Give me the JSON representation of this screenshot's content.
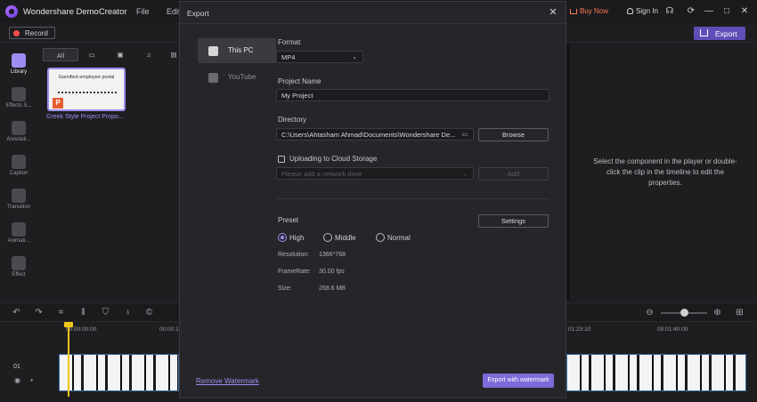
{
  "app": {
    "title": "Wondershare DemoCreator",
    "menu": [
      "File",
      "Edit"
    ],
    "buy_now": "Buy Now",
    "sign_in": "Sign In"
  },
  "toolbar": {
    "record_label": "Record",
    "export_label": "Export"
  },
  "sidebar": {
    "items": [
      {
        "label": "Library",
        "icon": "library-icon"
      },
      {
        "label": "Effects S...",
        "icon": "effects-store-icon"
      },
      {
        "label": "Annotati...",
        "icon": "annotation-icon"
      },
      {
        "label": "Caption",
        "icon": "caption-icon"
      },
      {
        "label": "Transition",
        "icon": "transition-icon"
      },
      {
        "label": "Animati...",
        "icon": "animation-icon"
      },
      {
        "label": "Effect",
        "icon": "effect-icon"
      }
    ]
  },
  "media": {
    "tab_all": "All",
    "thumb_title": "Gamified employee portal",
    "caption": "Greek Style Project Propo..."
  },
  "properties_hint": "Select the component in the player or double-click the clip in the timeline to edit the properties.",
  "timeline": {
    "times": [
      "00:00:00:00",
      "00:00:1",
      "01:23:10",
      "00:01:40:00"
    ],
    "track_number": "01"
  },
  "dialog": {
    "title": "Export",
    "nav": [
      {
        "label": "This PC",
        "icon": "pc-icon"
      },
      {
        "label": "YouTube",
        "icon": "youtube-icon"
      }
    ],
    "format_label": "Format",
    "format_value": "MP4",
    "project_name_label": "Project Name",
    "project_name_value": "My Project",
    "directory_label": "Directory",
    "directory_value": "C:\\Users\\Ahtasham Ahmad\\Documents\\Wondershare De...",
    "browse_label": "Browse",
    "cloud_label": "Uploading to Cloud Storage",
    "network_placeholder": "Please add a network drive",
    "add_label": "Add",
    "preset_label": "Preset",
    "settings_label": "Settings",
    "presets": [
      "High",
      "Middle",
      "Normal"
    ],
    "selected_preset": "High",
    "resolution_label": "Resolution:",
    "resolution_value": "1366*768",
    "framerate_label": "FrameRate:",
    "framerate_value": "30.00 fps",
    "size_label": "Size:",
    "size_value": "268.6 MB",
    "remove_watermark": "Remove Watermark",
    "export_with_watermark": "Export with watermark"
  },
  "colors": {
    "accent": "#9d8df0",
    "export_button": "#5e4fb8",
    "record_dot": "#ff4d4d",
    "buy_now": "#ff7a59",
    "playhead": "#f0c419"
  }
}
